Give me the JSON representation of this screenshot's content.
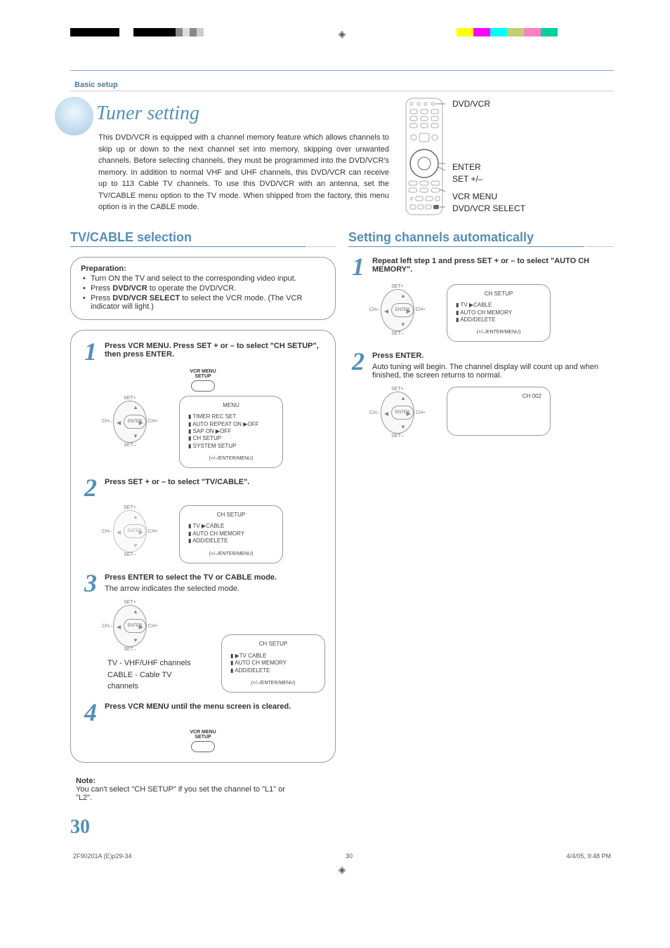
{
  "header": {
    "section": "Basic setup"
  },
  "title": "Tuner setting",
  "intro": "This DVD/VCR is equipped with a channel memory feature which allows channels to skip up or down to the next channel set into memory, skipping over unwanted channels. Before selecting channels, they must be programmed into the DVD/VCR's memory. In addition to normal VHF and UHF channels, this DVD/VCR can receive up to 113 Cable TV channels. To use this DVD/VCR with an antenna, set the TV/CABLE menu option to the TV mode. When shipped from the factory, this menu option is in the CABLE mode.",
  "remote_labels": {
    "dvd_vcr": "DVD/VCR",
    "enter": "ENTER",
    "set": "SET +/–",
    "vcr_menu": "VCR MENU",
    "select": "DVD/VCR SELECT"
  },
  "left_section": {
    "heading": "TV/CABLE selection",
    "prep_title": "Preparation:",
    "prep_bullets": [
      "Turn ON the TV and select to the corresponding video input.",
      "Press DVD/VCR to operate the DVD/VCR.",
      "Press DVD/VCR SELECT to select the VCR mode. (The VCR indicator will light.)"
    ],
    "steps": [
      {
        "n": "1",
        "text": "Press VCR MENU. Press SET + or – to select \"CH SETUP\", then press ENTER."
      },
      {
        "n": "2",
        "text": "Press SET + or – to select \"TV/CABLE\"."
      },
      {
        "n": "3",
        "text": "Press ENTER to select the TV or CABLE mode.",
        "sub": "The arrow indicates the selected mode."
      },
      {
        "n": "4",
        "text": "Press VCR MENU until the menu screen is cleared."
      }
    ],
    "vcr_menu_label_l1": "VCR MENU",
    "vcr_menu_label_l2": "SETUP",
    "menu_screen": {
      "title": "MENU",
      "items": [
        "TIMER REC SET",
        "AUTO REPEAT   ON ▶OFF",
        "SAP                    ON ▶OFF",
        "CH SETUP",
        "SYSTEM SETUP"
      ],
      "hint": "(+/–/ENTER/MENU)"
    },
    "ch_screen_a": {
      "title": "CH SETUP",
      "items": [
        "TV ▶CABLE",
        "AUTO CH MEMORY",
        "ADD/DELETE"
      ],
      "hint": "(+/–/ENTER/MENU)"
    },
    "ch_screen_b": {
      "title": "CH SETUP",
      "items": [
        "▶TV   CABLE",
        "AUTO CH MEMORY",
        "ADD/DELETE"
      ],
      "hint": "(+/–/ENTER/MENU)"
    },
    "mode_tv": "TV       - VHF/UHF channels",
    "mode_cable": "CABLE  - Cable TV channels",
    "note_title": "Note:",
    "note_text": "You can't select \"CH SETUP\" if you set the channel to \"L1\" or \"L2\"."
  },
  "right_section": {
    "heading": "Setting channels automatically",
    "steps": [
      {
        "n": "1",
        "text": "Repeat left step 1 and press SET + or – to select \"AUTO CH MEMORY\"."
      },
      {
        "n": "2",
        "text": "Press ENTER.",
        "sub": "Auto tuning will begin. The channel display will count up and when finished, the screen returns to normal."
      }
    ],
    "ch_screen": {
      "title": "CH SETUP",
      "items": [
        "TV ▶CABLE",
        "AUTO CH MEMORY",
        "ADD/DELETE"
      ],
      "hint": "(+/–/ENTER/MENU)"
    },
    "tuning_screen": {
      "text": "CH 002"
    }
  },
  "pad_labels": {
    "center": "ENTER",
    "top": "SET+",
    "bottom": "SET–",
    "left": "CH–",
    "right": "CH+"
  },
  "page_number": "30",
  "footer": {
    "left": "2F90201A (E)p29-34",
    "center": "30",
    "right": "4/4/05, 9:48 PM"
  },
  "color_bars": [
    "#ffff00",
    "#ff00ff",
    "#00ffff",
    "#c0d070",
    "#ff80c0",
    "#00d0a0"
  ]
}
